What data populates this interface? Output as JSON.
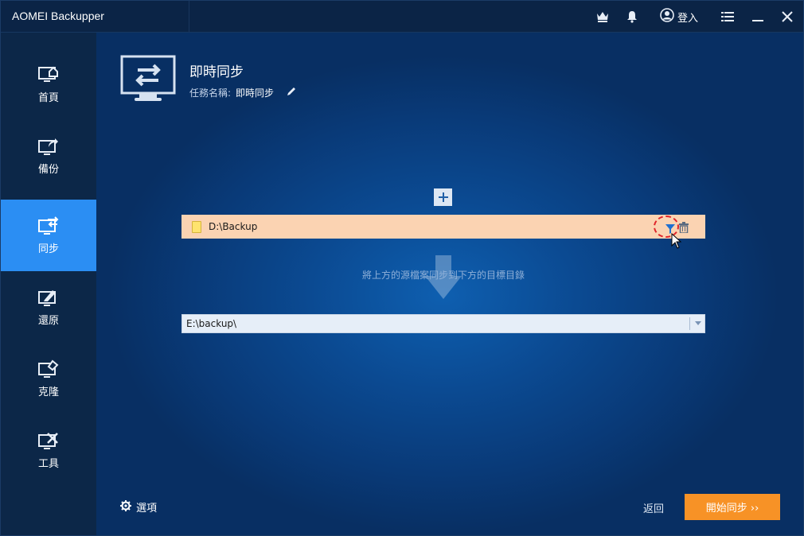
{
  "window": {
    "title": "AOMEI Backupper",
    "login_label": "登入",
    "icons": [
      "crown-icon",
      "bell-icon",
      "user-icon",
      "menu-icon",
      "minimize-icon",
      "close-icon"
    ]
  },
  "sidebar": {
    "items": [
      {
        "label": "首頁",
        "icon": "home-icon",
        "active": false
      },
      {
        "label": "備份",
        "icon": "backup-icon",
        "active": false
      },
      {
        "label": "同步",
        "icon": "sync-icon",
        "active": true
      },
      {
        "label": "還原",
        "icon": "restore-icon",
        "active": false
      },
      {
        "label": "克隆",
        "icon": "clone-icon",
        "active": false
      },
      {
        "label": "工具",
        "icon": "tools-icon",
        "active": false
      }
    ]
  },
  "task": {
    "title": "即時同步",
    "name_label": "任務名稱:",
    "name_value": "即時同步"
  },
  "source": {
    "path": "D:\\Backup"
  },
  "hint": "將上方的源檔案同步到下方的目標目錄",
  "destination": {
    "path": "E:\\backup\\"
  },
  "footer": {
    "options_label": "選項",
    "back_label": "返回",
    "start_label": "開始同步 ››"
  },
  "colors": {
    "accent": "#2b8ef3",
    "start_button": "#f79226",
    "source_row": "#fbd3b2",
    "filter_highlight": "#e0242a"
  }
}
